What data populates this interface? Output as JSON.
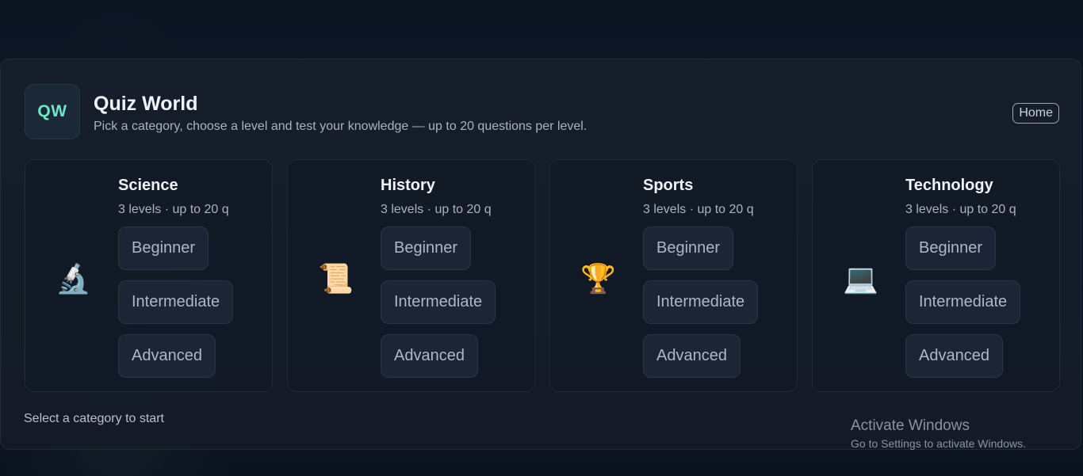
{
  "app": {
    "logo_text": "QW",
    "title": "Quiz World",
    "subtitle": "Pick a category, choose a level and test your knowledge — up to 20 questions per level.",
    "home_label": "Home"
  },
  "categories": [
    {
      "title": "Science",
      "meta": "3 levels · up to 20 q",
      "icon": "microscope-icon",
      "glyph": "🔬",
      "levels": [
        "Beginner",
        "Intermediate",
        "Advanced"
      ]
    },
    {
      "title": "History",
      "meta": "3 levels · up to 20 q",
      "icon": "scroll-icon",
      "glyph": "📜",
      "levels": [
        "Beginner",
        "Intermediate",
        "Advanced"
      ]
    },
    {
      "title": "Sports",
      "meta": "3 levels · up to 20 q",
      "icon": "trophy-icon",
      "glyph": "🏆",
      "levels": [
        "Beginner",
        "Intermediate",
        "Advanced"
      ]
    },
    {
      "title": "Technology",
      "meta": "3 levels · up to 20 q",
      "icon": "laptop-icon",
      "glyph": "💻",
      "levels": [
        "Beginner",
        "Intermediate",
        "Advanced"
      ]
    }
  ],
  "status_text": "Select a category to start",
  "watermark": {
    "title": "Activate Windows",
    "subtitle": "Go to Settings to activate Windows."
  },
  "colors": {
    "background": "#0c1422",
    "accent": "#6ee7c6",
    "card_border": "#1f2a3a",
    "button_bg": "#1c2535"
  }
}
